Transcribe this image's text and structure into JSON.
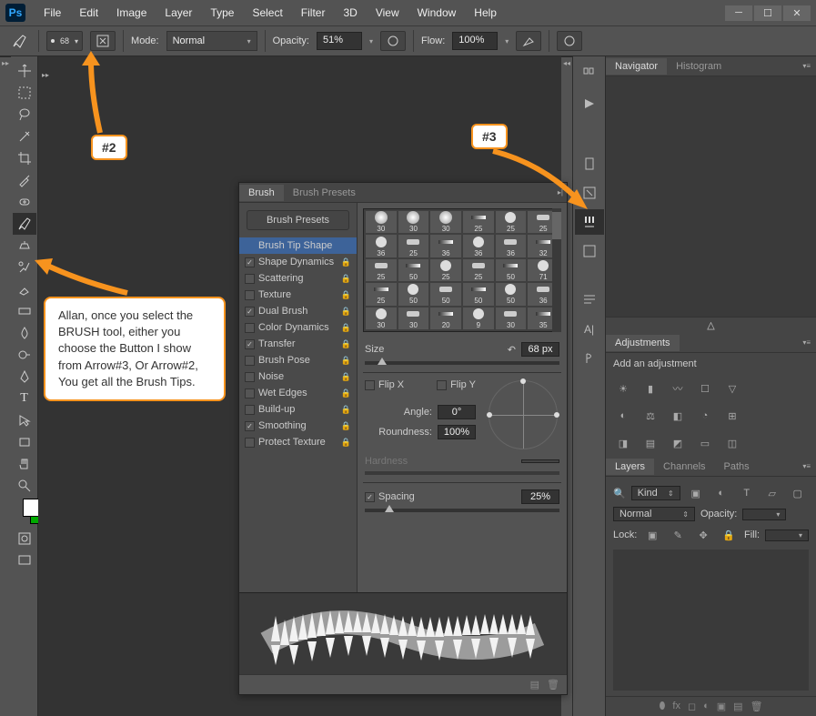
{
  "titlebar": {
    "logo": "Ps",
    "menus": [
      "File",
      "Edit",
      "Image",
      "Layer",
      "Type",
      "Select",
      "Filter",
      "3D",
      "View",
      "Window",
      "Help"
    ]
  },
  "options_bar": {
    "brush_size": "68",
    "mode_label": "Mode:",
    "mode_value": "Normal",
    "opacity_label": "Opacity:",
    "opacity_value": "51%",
    "flow_label": "Flow:",
    "flow_value": "100%"
  },
  "brush_panel": {
    "tabs": [
      "Brush",
      "Brush Presets"
    ],
    "presets_btn": "Brush Presets",
    "tip_shape": "Brush Tip Shape",
    "options": [
      {
        "label": "Shape Dynamics",
        "checked": true,
        "lock": true
      },
      {
        "label": "Scattering",
        "checked": false,
        "lock": true
      },
      {
        "label": "Texture",
        "checked": false,
        "lock": true
      },
      {
        "label": "Dual Brush",
        "checked": true,
        "lock": true
      },
      {
        "label": "Color Dynamics",
        "checked": false,
        "lock": true
      },
      {
        "label": "Transfer",
        "checked": true,
        "lock": true
      },
      {
        "label": "Brush Pose",
        "checked": false,
        "lock": true
      },
      {
        "label": "Noise",
        "checked": false,
        "lock": true
      },
      {
        "label": "Wet Edges",
        "checked": false,
        "lock": true
      },
      {
        "label": "Build-up",
        "checked": false,
        "lock": true
      },
      {
        "label": "Smoothing",
        "checked": true,
        "lock": true
      },
      {
        "label": "Protect Texture",
        "checked": false,
        "lock": true
      }
    ],
    "tips": [
      [
        "30",
        "30",
        "30",
        "25",
        "25",
        "25"
      ],
      [
        "36",
        "25",
        "36",
        "36",
        "36",
        "32"
      ],
      [
        "25",
        "50",
        "25",
        "25",
        "50",
        "71"
      ],
      [
        "25",
        "50",
        "50",
        "50",
        "50",
        "36"
      ],
      [
        "30",
        "30",
        "20",
        "9",
        "30",
        "35"
      ]
    ],
    "size_label": "Size",
    "size_value": "68 px",
    "flipx": "Flip X",
    "flipy": "Flip Y",
    "angle_label": "Angle:",
    "angle_value": "0°",
    "roundness_label": "Roundness:",
    "roundness_value": "100%",
    "hardness_label": "Hardness",
    "spacing_label": "Spacing",
    "spacing_value": "25%"
  },
  "panels": {
    "navigator": "Navigator",
    "histogram": "Histogram",
    "adjustments": "Adjustments",
    "add_adj": "Add an adjustment",
    "layers": "Layers",
    "channels": "Channels",
    "paths": "Paths",
    "kind": "Kind",
    "normal": "Normal",
    "opacity": "Opacity:",
    "lock": "Lock:",
    "fill": "Fill:"
  },
  "callouts": {
    "tag2": "#2",
    "tag3": "#3",
    "body": "Allan, once you select the BRUSH tool, either you choose the Button I show from Arrow#3, Or Arrow#2, You get all the Brush Tips."
  }
}
